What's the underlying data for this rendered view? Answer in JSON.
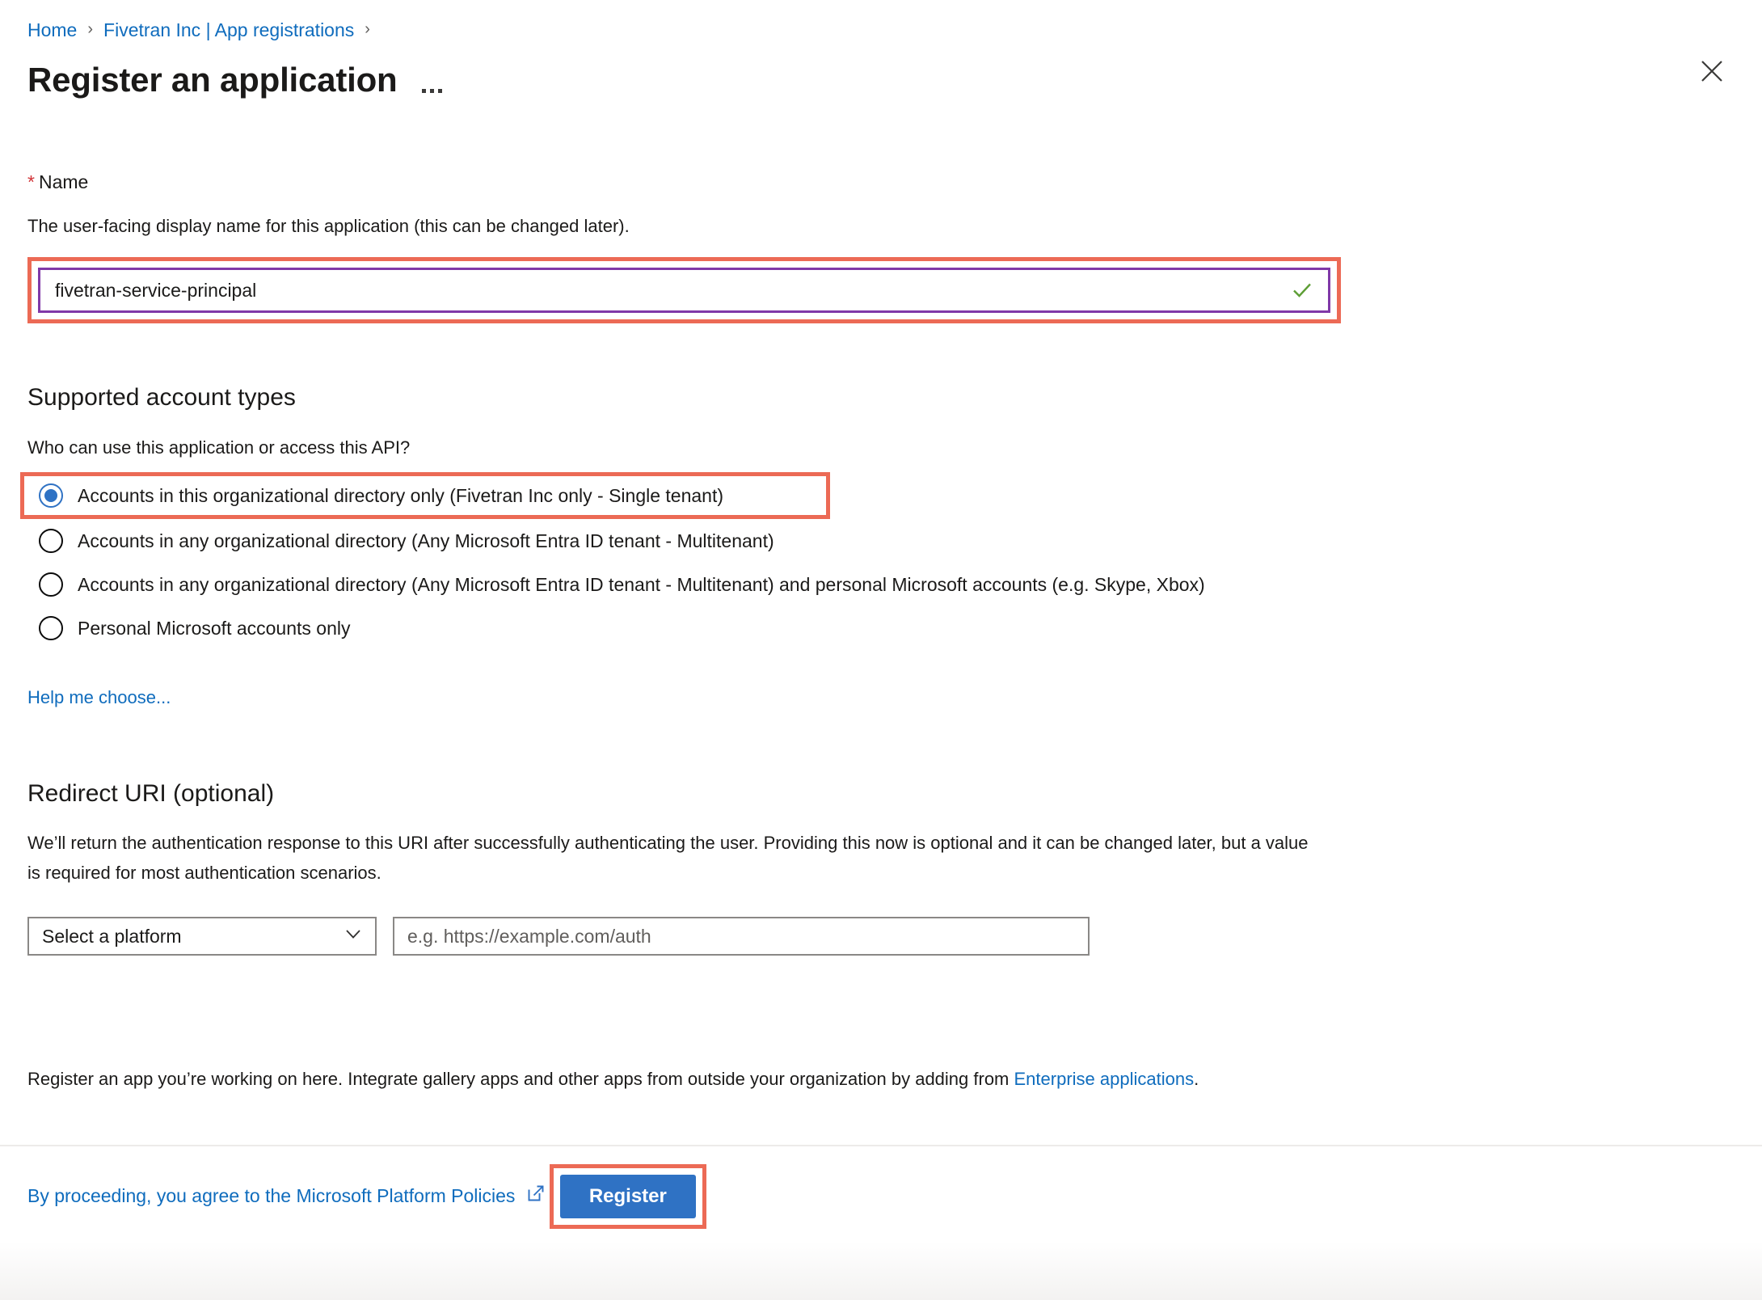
{
  "breadcrumb": {
    "items": [
      {
        "label": "Home"
      },
      {
        "label": "Fivetran Inc | App registrations"
      }
    ],
    "separator": "›"
  },
  "header": {
    "title": "Register an application",
    "more_actions": "...",
    "close_label": "Close"
  },
  "name_field": {
    "label": "Name",
    "required_marker": "*",
    "description": "The user-facing display name for this application (this can be changed later).",
    "value": "fivetran-service-principal",
    "placeholder": "",
    "valid_icon": "checkmark-icon"
  },
  "account_types": {
    "heading": "Supported account types",
    "question": "Who can use this application or access this API?",
    "options": [
      {
        "label": "Accounts in this organizational directory only (Fivetran Inc only - Single tenant)",
        "selected": true,
        "highlighted": true
      },
      {
        "label": "Accounts in any organizational directory (Any Microsoft Entra ID tenant - Multitenant)",
        "selected": false,
        "highlighted": false
      },
      {
        "label": "Accounts in any organizational directory (Any Microsoft Entra ID tenant - Multitenant) and personal Microsoft accounts (e.g. Skype, Xbox)",
        "selected": false,
        "highlighted": false
      },
      {
        "label": "Personal Microsoft accounts only",
        "selected": false,
        "highlighted": false
      }
    ],
    "help_link": "Help me choose..."
  },
  "redirect_uri": {
    "heading": "Redirect URI (optional)",
    "description": "We’ll return the authentication response to this URI after successfully authenticating the user. Providing this now is optional and it can be changed later, but a value is required for most authentication scenarios.",
    "platform_selected": "Select a platform",
    "uri_value": "",
    "uri_placeholder": "e.g. https://example.com/auth"
  },
  "note": {
    "text_before": "Register an app you’re working on here. Integrate gallery apps and other apps from outside your organization by adding from ",
    "link": "Enterprise applications",
    "text_after": "."
  },
  "footer": {
    "policies_text": "By proceeding, you agree to the Microsoft Platform Policies",
    "policies_icon": "external-link-icon",
    "register_label": "Register"
  },
  "colors": {
    "accent_blue": "#2f72c4",
    "link_blue": "#0f6cbd",
    "annotation_red": "#ec6a55",
    "focus_purple": "#8039a8",
    "valid_green": "#5d9e35",
    "required_red": "#d13438"
  }
}
